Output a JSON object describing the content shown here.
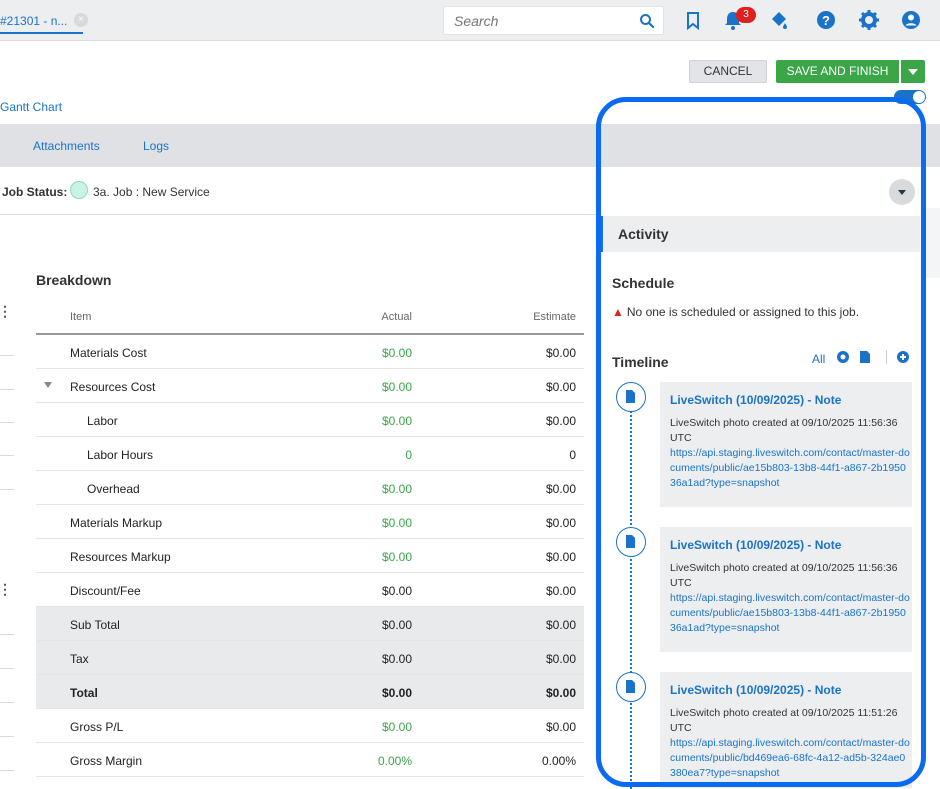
{
  "header": {
    "tab_label": "#21301 - n...",
    "search_placeholder": "Search",
    "notification_count": "3",
    "icons": [
      "bookmark-icon",
      "bell-icon",
      "paint-bucket-icon",
      "help-icon",
      "gear-icon",
      "user-icon"
    ]
  },
  "actions": {
    "cancel_label": "CANCEL",
    "save_label": "SAVE AND FINISH"
  },
  "gantt_link": "Gantt Chart",
  "tabs": [
    "Attachments",
    "Logs"
  ],
  "job_status": {
    "label": "Job Status:",
    "value": "3a. Job : New Service",
    "color": "#c9f3e3"
  },
  "breakdown": {
    "title": "Breakdown",
    "headers": {
      "item": "Item",
      "actual": "Actual",
      "estimate": "Estimate"
    },
    "rows": [
      {
        "item": "Materials Cost",
        "actual": "$0.00",
        "estimate": "$0.00"
      },
      {
        "item": "Resources Cost",
        "actual": "$0.00",
        "estimate": "$0.00"
      },
      {
        "item": "Labor",
        "actual": "$0.00",
        "estimate": "$0.00"
      },
      {
        "item": "Labor Hours",
        "actual": "0",
        "estimate": "0"
      },
      {
        "item": "Overhead",
        "actual": "$0.00",
        "estimate": "$0.00"
      },
      {
        "item": "Materials Markup",
        "actual": "$0.00",
        "estimate": "$0.00"
      },
      {
        "item": "Resources Markup",
        "actual": "$0.00",
        "estimate": "$0.00"
      },
      {
        "item": "Discount/Fee",
        "actual": "$0.00",
        "estimate": "$0.00"
      },
      {
        "item": "Sub Total",
        "actual": "$0.00",
        "estimate": "$0.00"
      },
      {
        "item": "Tax",
        "actual": "$0.00",
        "estimate": "$0.00"
      },
      {
        "item": "Total",
        "actual": "$0.00",
        "estimate": "$0.00"
      },
      {
        "item": "Gross P/L",
        "actual": "$0.00",
        "estimate": "$0.00"
      },
      {
        "item": "Gross Margin",
        "actual": "0.00%",
        "estimate": "0.00%"
      }
    ]
  },
  "activity": {
    "title": "Activity",
    "schedule_title": "Schedule",
    "schedule_warning": "No one is scheduled or assigned to this job.",
    "timeline_title": "Timeline",
    "filter_all": "All",
    "entries": [
      {
        "title": "LiveSwitch (10/09/2025) - Note",
        "body": "LiveSwitch photo created at 09/10/2025 11:56:36 UTC",
        "link": "https://api.staging.liveswitch.com/contact/master-documents/public/ae15b803-13b8-44f1-a867-2b195036a1ad?type=snapshot"
      },
      {
        "title": "LiveSwitch (10/09/2025) - Note",
        "body": "LiveSwitch photo created at 09/10/2025 11:56:36 UTC",
        "link": "https://api.staging.liveswitch.com/contact/master-documents/public/ae15b803-13b8-44f1-a867-2b195036a1ad?type=snapshot"
      },
      {
        "title": "LiveSwitch (10/09/2025) - Note",
        "body": "LiveSwitch photo created at 09/10/2025 11:51:26 UTC",
        "link": "https://api.staging.liveswitch.com/contact/master-documents/public/bd469ea6-68fc-4a12-ad5b-324ae0380ea7?type=snapshot"
      }
    ]
  },
  "colors": {
    "accent": "#1a73c8",
    "success": "#3aa648",
    "highlight": "#0a6af2"
  }
}
